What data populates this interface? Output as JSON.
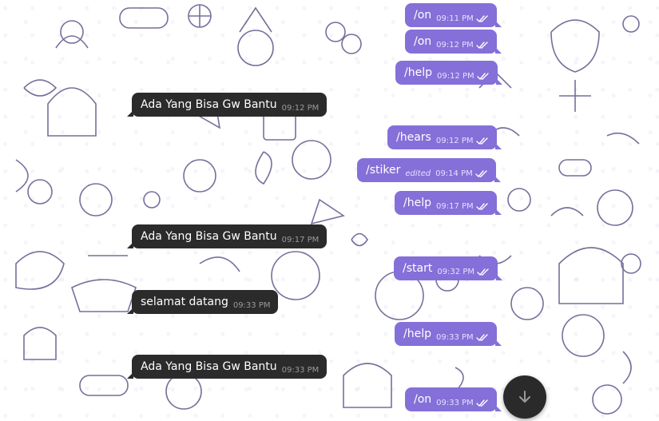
{
  "chat": {
    "messages": [
      {
        "dir": "out",
        "text": "/on",
        "time": "09:11 PM",
        "edited": false
      },
      {
        "dir": "out",
        "text": "/on",
        "time": "09:12 PM",
        "edited": false
      },
      {
        "dir": "out",
        "text": "/help",
        "time": "09:12 PM",
        "edited": false
      },
      {
        "dir": "in",
        "text": "Ada Yang Bisa Gw Bantu",
        "time": "09:12 PM",
        "edited": false
      },
      {
        "dir": "out",
        "text": "/hears",
        "time": "09:12 PM",
        "edited": false
      },
      {
        "dir": "out",
        "text": "/stiker",
        "time": "09:14 PM",
        "edited": true,
        "edited_label": "edited"
      },
      {
        "dir": "out",
        "text": "/help",
        "time": "09:17 PM",
        "edited": false
      },
      {
        "dir": "in",
        "text": "Ada Yang Bisa Gw Bantu",
        "time": "09:17 PM",
        "edited": false
      },
      {
        "dir": "out",
        "text": "/start",
        "time": "09:32 PM",
        "edited": false
      },
      {
        "dir": "in",
        "text": "selamat datang",
        "time": "09:33 PM",
        "edited": false
      },
      {
        "dir": "out",
        "text": "/help",
        "time": "09:33 PM",
        "edited": false
      },
      {
        "dir": "in",
        "text": "Ada Yang Bisa Gw Bantu",
        "time": "09:33 PM",
        "edited": false
      },
      {
        "dir": "out",
        "text": "/on",
        "time": "09:33 PM",
        "edited": false
      }
    ]
  },
  "colors": {
    "incoming_bubble": "#2b2b2b",
    "outgoing_bubble": "#8470d8",
    "wallpaper_doodle": "#4a3f7a",
    "scroll_button": "#2a2a2a"
  },
  "icons": {
    "read_status": "double-check-icon",
    "scroll_down": "arrow-down-icon"
  }
}
